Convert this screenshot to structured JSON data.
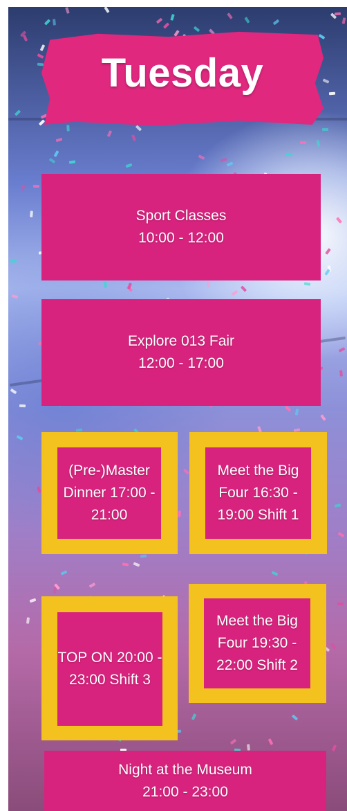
{
  "title": "Tuesday",
  "colors": {
    "pink": "#d8237e",
    "yellow": "#f4c21f",
    "text": "#ffffff"
  },
  "events": {
    "sport_classes": {
      "name": "Sport Classes",
      "time": "10:00 - 12:00"
    },
    "explore_fair": {
      "name": "Explore 013 Fair",
      "time": "12:00 - 17:00"
    },
    "master_dinner": {
      "name_line1": "(Pre-)Master",
      "name_line2": "Dinner",
      "time": "17:00 - 21:00"
    },
    "big_four_shift1": {
      "name_line1": "Meet the Big",
      "name_line2": "Four",
      "time": "16:30 - 19:00",
      "shift": "Shift 1"
    },
    "top_on": {
      "name": "TOP ON",
      "start": "20:00",
      "dash": "-",
      "end": "23:00",
      "shift": "Shift 3"
    },
    "big_four_shift2": {
      "name_line1": "Meet the Big",
      "name_line2": "Four",
      "time": "19:30 - 22:00",
      "shift": "Shift 2"
    },
    "night_museum": {
      "name": "Night at the Museum",
      "time": "21:00 - 23:00"
    }
  }
}
